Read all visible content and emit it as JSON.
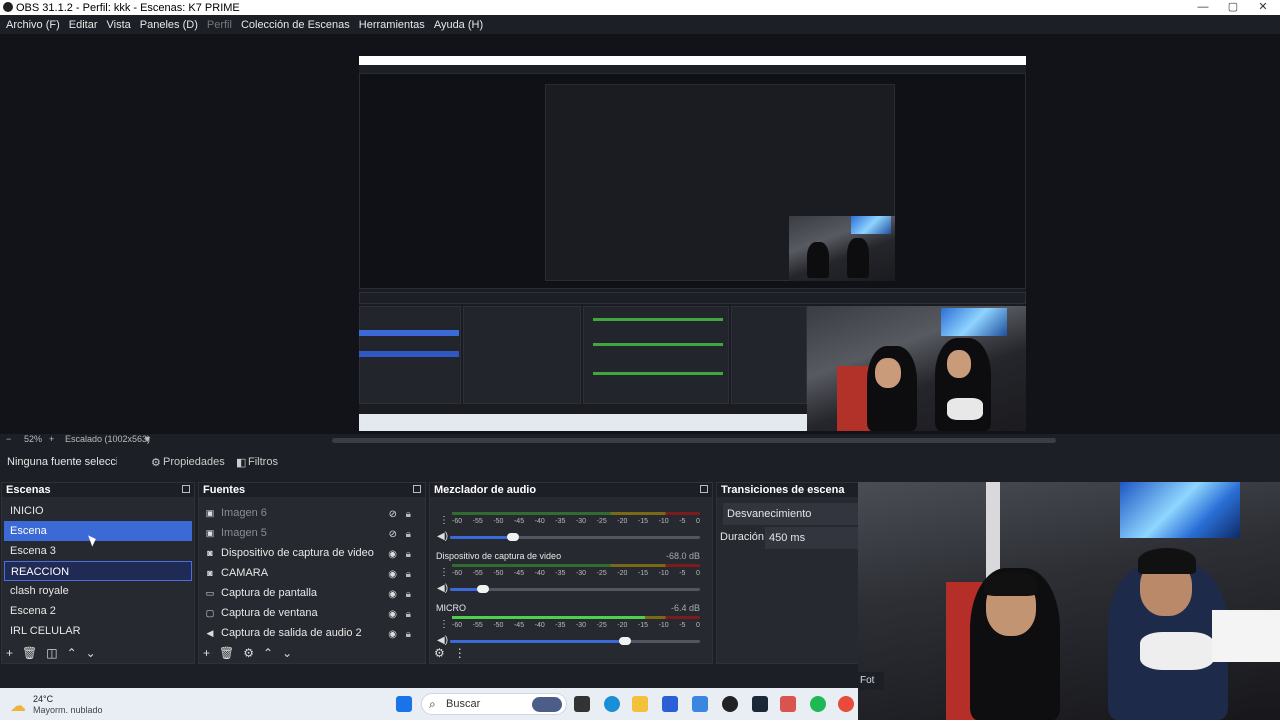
{
  "window": {
    "title": "OBS 31.1.2 - Perfil: kkk - Escenas: K7 PRIME"
  },
  "menu": [
    "Archivo (F)",
    "Editar",
    "Vista",
    "Paneles (D)",
    "Perfil",
    "Colección de Escenas",
    "Herramientas",
    "Ayuda (H)"
  ],
  "zoom": {
    "minus": "−",
    "percent": "52%",
    "plus": "+",
    "scale": "Escalado (1002x563)"
  },
  "context": {
    "no_source": "Ninguna fuente seleccionada",
    "properties": "Propiedades",
    "filters": "Filtros"
  },
  "scenes": {
    "title": "Escenas",
    "items": [
      "INICIO",
      "Escena",
      "Escena 3",
      "REACCION",
      "clash royale",
      "Escena 2",
      "IRL CELULAR"
    ],
    "selected": "Escena",
    "outlined": "REACCION"
  },
  "sources": {
    "title": "Fuentes",
    "items": [
      {
        "name": "Imagen 6",
        "icon": "image-icon",
        "visible": false
      },
      {
        "name": "Imagen 5",
        "icon": "image-icon",
        "visible": false
      },
      {
        "name": "Dispositivo de captura de video",
        "icon": "camera-icon",
        "visible": true
      },
      {
        "name": "CAMARA",
        "icon": "camera-icon",
        "visible": true
      },
      {
        "name": "Captura de pantalla",
        "icon": "monitor-icon",
        "visible": true
      },
      {
        "name": "Captura de ventana",
        "icon": "window-icon",
        "visible": true
      },
      {
        "name": "Captura de salida de audio 2",
        "icon": "speaker-icon",
        "visible": true
      }
    ]
  },
  "mixer": {
    "title": "Mezclador de audio",
    "ticks": [
      "-60",
      "-55",
      "-50",
      "-45",
      "-40",
      "-35",
      "-30",
      "-25",
      "-20",
      "-15",
      "-10",
      "-5",
      "0"
    ],
    "channels": [
      {
        "name": "",
        "db": "",
        "level": 0.0,
        "volume": 0.25
      },
      {
        "name": "Dispositivo de captura de video",
        "db": "-68.0 dB",
        "level": 0.0,
        "volume": 0.13
      },
      {
        "name": "MICRO",
        "db": "-6.4 dB",
        "level": 0.78,
        "volume": 0.7
      }
    ]
  },
  "transitions": {
    "title": "Transiciones de escena",
    "selected": "Desvanecimiento",
    "duration_label": "Duración",
    "duration_value": "450 ms"
  },
  "webcam": {
    "corner_text": "Fot"
  },
  "taskbar": {
    "weather_temp": "24°C",
    "weather_desc": "Mayorm. nublado",
    "search_placeholder": "Buscar"
  }
}
